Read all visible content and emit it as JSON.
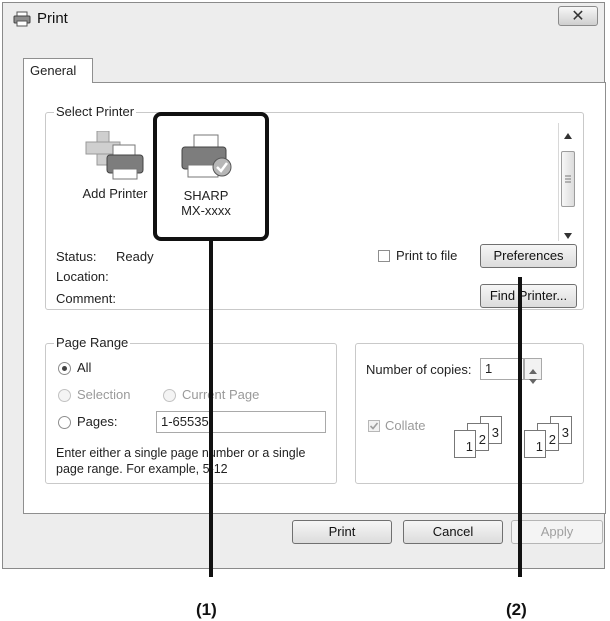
{
  "window": {
    "title": "Print",
    "close_glyph": "✕",
    "icon": "printer-icon"
  },
  "tabs": [
    {
      "label": "General"
    }
  ],
  "select_printer": {
    "label": "Select Printer",
    "printers": [
      {
        "label": "Add Printer",
        "icon": "add-printer-icon"
      },
      {
        "label_line1": "SHARP",
        "label_line2": "MX-xxxx",
        "icon": "printer-default-icon"
      }
    ],
    "status_label": "Status:",
    "status_value": "Ready",
    "location_label": "Location:",
    "comment_label": "Comment:",
    "print_to_file_label": "Print to file",
    "preferences_label": "Preferences",
    "find_printer_label": "Find Printer..."
  },
  "page_range": {
    "label": "Page Range",
    "all_label": "All",
    "selection_label": "Selection",
    "current_page_label": "Current Page",
    "pages_label": "Pages:",
    "pages_value": "1-65535",
    "help_line1": "Enter either a single page number or a single",
    "help_line2": "page range.  For example, 5-12"
  },
  "copies": {
    "number_label": "Number of copies:",
    "number_value": "1",
    "collate_label": "Collate",
    "collate_pages": [
      "1",
      "2",
      "3"
    ]
  },
  "buttons": {
    "print": "Print",
    "cancel": "Cancel",
    "apply": "Apply"
  },
  "callouts": {
    "c1": "(1)",
    "c2": "(2)"
  }
}
